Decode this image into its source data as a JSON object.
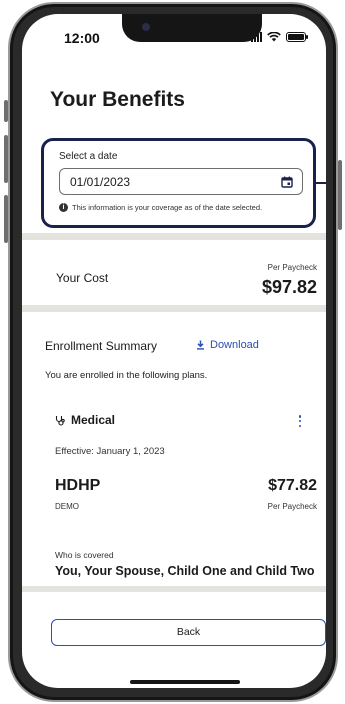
{
  "status_bar": {
    "time": "12:00",
    "icons": [
      "signal-icon",
      "wifi-icon",
      "battery-icon"
    ]
  },
  "page": {
    "title": "Your Benefits"
  },
  "date_selector": {
    "label": "Select a date",
    "value": "01/01/2023",
    "icon": "calendar-icon",
    "info_text": "This information is your coverage as of the date selected."
  },
  "cost": {
    "label": "Your Cost",
    "period": "Per Paycheck",
    "amount": "$97.82"
  },
  "enrollment": {
    "title": "Enrollment Summary",
    "download_label": "Download",
    "enrolled_text": "You are enrolled in the following plans.",
    "plan": {
      "category": "Medical",
      "category_icon": "stethoscope-icon",
      "effective": "Effective: January 1, 2023",
      "name": "HDHP",
      "code": "DEMO",
      "cost": "$77.82",
      "period": "Per Paycheck",
      "covered_label": "Who is covered",
      "covered_value": "You, Your Spouse, Child One and Child Two"
    }
  },
  "footer": {
    "back_label": "Back"
  },
  "colors": {
    "accent": "#2c4fb0",
    "highlight_border": "#18224a",
    "divider": "#e5e3de"
  }
}
